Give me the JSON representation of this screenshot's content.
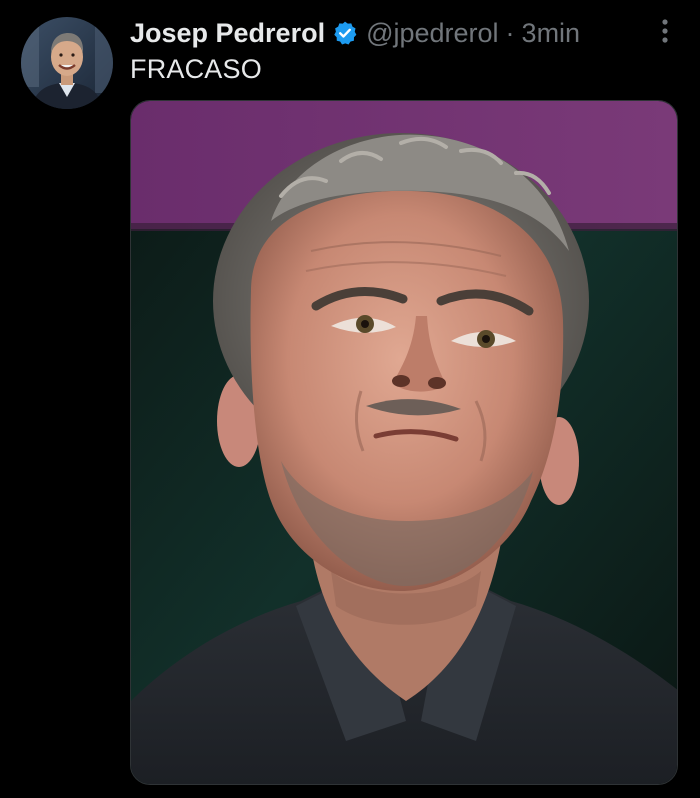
{
  "tweet": {
    "author": {
      "display_name": "Josep Pedrerol",
      "handle": "@jpedrerol",
      "verified": true,
      "avatar_icon": "profile-photo"
    },
    "separator": "·",
    "timestamp": "3min",
    "text": "FRACASO",
    "media": {
      "type": "photo",
      "subject_icon": "coach-portrait"
    },
    "more_icon": "vertical-ellipsis-icon"
  },
  "colors": {
    "background": "#000000",
    "primary_text": "#e7e9ea",
    "secondary_text": "#71767b",
    "verified_blue": "#1d9bf0",
    "photo_banner": "#6e2f6e",
    "photo_background": "#0d1f1c"
  }
}
